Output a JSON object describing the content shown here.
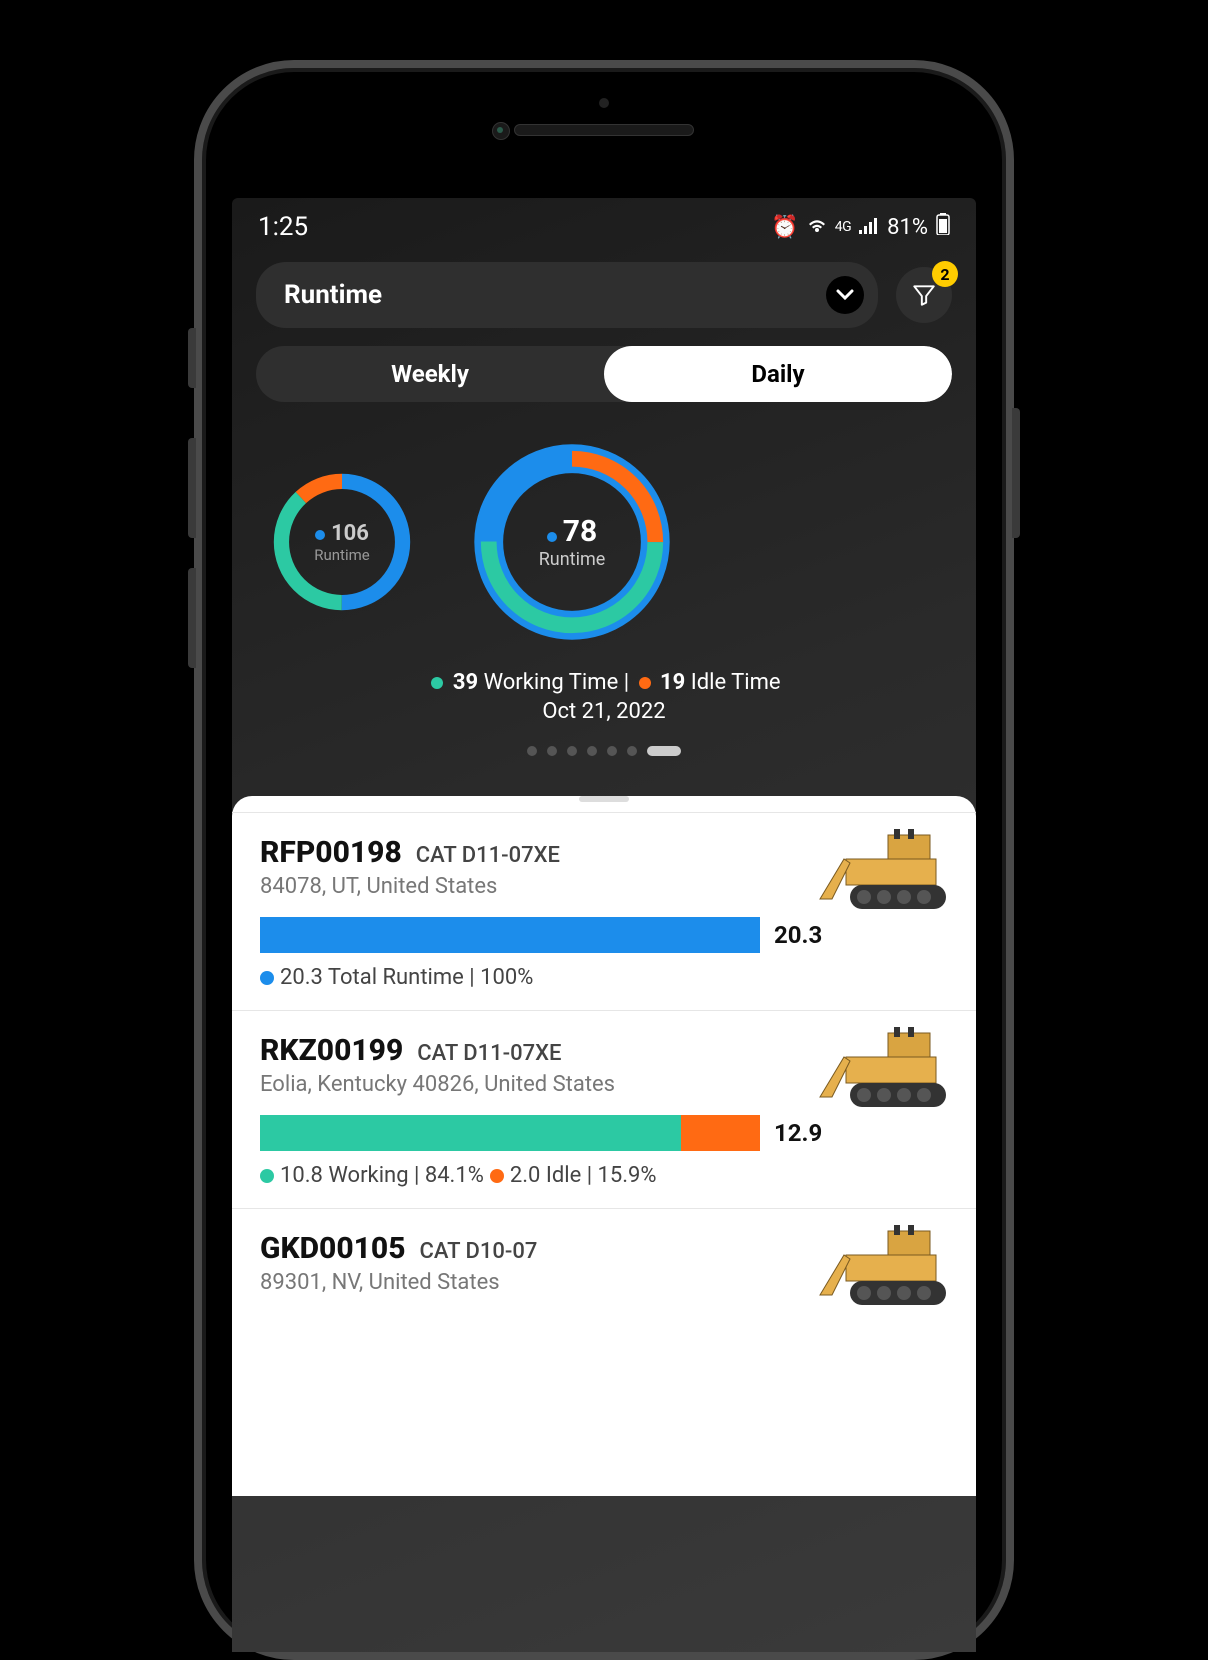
{
  "status_bar": {
    "time": "1:25",
    "battery_text": "81%",
    "network_label": "4G"
  },
  "header": {
    "dropdown_label": "Runtime",
    "filter_badge": "2"
  },
  "tabs": {
    "weekly": "Weekly",
    "daily": "Daily",
    "active": "daily"
  },
  "chart_data": [
    {
      "type": "pie",
      "title": "Runtime",
      "total": 106,
      "series": [
        {
          "name": "Blue",
          "value": 53,
          "color": "#1c8deb"
        },
        {
          "name": "Teal",
          "value": 40,
          "color": "#2cc9a3"
        },
        {
          "name": "Orange",
          "value": 13,
          "color": "#ff6a13"
        }
      ]
    },
    {
      "type": "pie",
      "title": "Runtime",
      "total": 78,
      "series": [
        {
          "name": "Blue",
          "value": 20,
          "color": "#1c8deb"
        },
        {
          "name": "Working Time",
          "value": 39,
          "color": "#2cc9a3"
        },
        {
          "name": "Idle Time",
          "value": 19,
          "color": "#ff6a13"
        }
      ]
    }
  ],
  "donut_small": {
    "value": "106",
    "label": "Runtime"
  },
  "donut_large": {
    "value": "78",
    "label": "Runtime"
  },
  "legend": {
    "working_value": "39",
    "working_label": "Working Time",
    "idle_value": "19",
    "idle_label": "Idle Time",
    "date": "Oct 21, 2022"
  },
  "assets": [
    {
      "id": "RFP00198",
      "model": "CAT D11-07XE",
      "location": "84078, UT, United States",
      "bar_value": "20.3",
      "segments": [
        {
          "color": "#1c8deb",
          "pct": 100
        }
      ],
      "legend_parts": [
        {
          "color": "#1c8deb",
          "text": "20.3 Total Runtime | 100%"
        }
      ]
    },
    {
      "id": "RKZ00199",
      "model": "CAT D11-07XE",
      "location": "Eolia, Kentucky 40826, United States",
      "bar_value": "12.9",
      "segments": [
        {
          "color": "#2cc9a3",
          "pct": 84.1
        },
        {
          "color": "#ff6a13",
          "pct": 15.9
        }
      ],
      "legend_parts": [
        {
          "color": "#2cc9a3",
          "text": "10.8 Working | 84.1%"
        },
        {
          "color": "#ff6a13",
          "text": "2.0 Idle | 15.9%"
        }
      ]
    },
    {
      "id": "GKD00105",
      "model": "CAT D10-07",
      "location": "89301, NV, United States",
      "bar_value": "",
      "segments": [],
      "legend_parts": []
    }
  ],
  "colors": {
    "blue": "#1c8deb",
    "teal": "#2cc9a3",
    "orange": "#ff6a13",
    "yellow": "#ffcc00"
  }
}
